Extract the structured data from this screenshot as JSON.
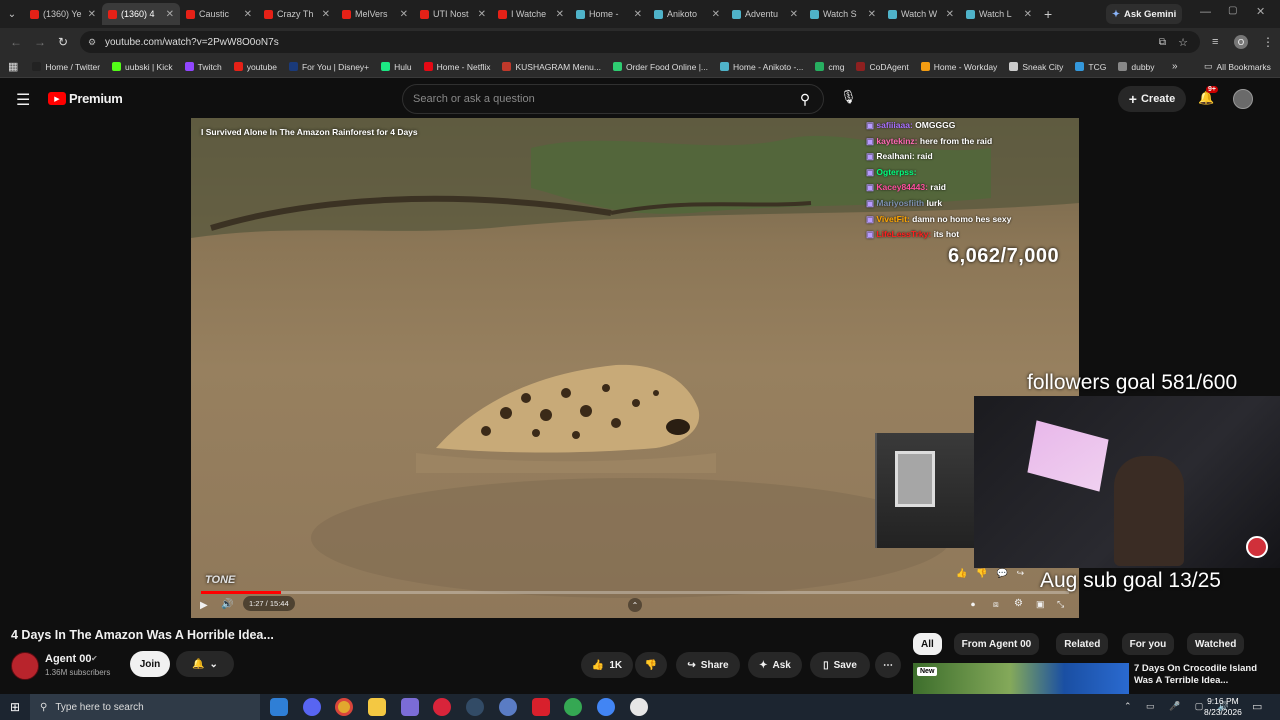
{
  "tabs": [
    {
      "title": "(1360) Ye",
      "color": "#e62117"
    },
    {
      "title": "(1360) 4",
      "color": "#e62117",
      "active": true
    },
    {
      "title": "Caustic",
      "color": "#e62117"
    },
    {
      "title": "Crazy Th",
      "color": "#e62117"
    },
    {
      "title": "MelVers",
      "color": "#e62117"
    },
    {
      "title": "UTI Nost",
      "color": "#e62117"
    },
    {
      "title": "I Watche",
      "color": "#e62117"
    },
    {
      "title": "Home -",
      "color": "#4fb3c9"
    },
    {
      "title": "Anikoto",
      "color": "#4fb3c9"
    },
    {
      "title": "Adventu",
      "color": "#4fb3c9"
    },
    {
      "title": "Watch S",
      "color": "#4fb3c9"
    },
    {
      "title": "Watch W",
      "color": "#4fb3c9"
    },
    {
      "title": "Watch L",
      "color": "#4fb3c9"
    }
  ],
  "ask_gemini": "Ask Gemini",
  "url": "youtube.com/watch?v=2PwW8O0oN7s",
  "bookmarks": [
    {
      "label": "Home / Twitter",
      "color": "#222"
    },
    {
      "label": "uubski | Kick",
      "color": "#53fc18"
    },
    {
      "label": "Twitch",
      "color": "#9146ff"
    },
    {
      "label": "youtube",
      "color": "#e62117"
    },
    {
      "label": "For You | Disney+",
      "color": "#1a3a7a"
    },
    {
      "label": "Hulu",
      "color": "#1ce783"
    },
    {
      "label": "Home - Netflix",
      "color": "#e50914"
    },
    {
      "label": "KUSHAGRAM Menu...",
      "color": "#c0392b"
    },
    {
      "label": "Order Food Online |...",
      "color": "#2ecc71"
    },
    {
      "label": "Home - Anikoto -...",
      "color": "#4fb3c9"
    },
    {
      "label": "cmg",
      "color": "#27ae60"
    },
    {
      "label": "CoDAgent",
      "color": "#8e2020"
    },
    {
      "label": "Home - Workday",
      "color": "#f39c12"
    },
    {
      "label": "Sneak City",
      "color": "#ccc"
    },
    {
      "label": "TCG",
      "color": "#3498db"
    },
    {
      "label": "dubby",
      "color": "#888"
    }
  ],
  "all_bookmarks": "All Bookmarks",
  "logo_text": "Premium",
  "search_placeholder": "Search or ask a question",
  "create_label": "Create",
  "notif_badge": "9+",
  "video": {
    "title_overlay": "I Survived Alone In The Amazon Rainforest for 4 Days",
    "time": "1:27 / 15:44",
    "progress": 0.092,
    "brand": "TONE",
    "goal_count": "6,062/7,000",
    "followers_goal": "followers goal 581/600",
    "sub_goal": "Aug sub goal 13/25"
  },
  "chat": [
    {
      "user": "safiiiaaa:",
      "msg": "OMGGGG",
      "color": "#a970ff"
    },
    {
      "user": "kaytekinz:",
      "msg": "here from the raid",
      "color": "#ff69b4"
    },
    {
      "user": "Realhani:",
      "msg": "raid",
      "color": "#ffffff"
    },
    {
      "user": "Ogterpss:",
      "msg": "",
      "color": "#00ff7f"
    },
    {
      "user": "Kacey84443:",
      "msg": "raid",
      "color": "#ff4fa0"
    },
    {
      "user": "Mariyosfiith",
      "msg": "lurk",
      "color": "#7d8fb0"
    },
    {
      "user": "VivetFit:",
      "msg": "damn no homo hes sexy",
      "color": "#ffa500"
    },
    {
      "user": "LifeLessTrky:",
      "msg": "its hot",
      "color": "#ff2020"
    }
  ],
  "meta": {
    "title": "4 Days In The Amazon Was A Horrible Idea...",
    "channel": "Agent 00",
    "subs": "1.36M subscribers",
    "join": "Join",
    "likes": "1K",
    "share": "Share",
    "ask": "Ask",
    "save": "Save"
  },
  "chips": [
    "All",
    "From Agent 00",
    "Related",
    "For you",
    "Watched"
  ],
  "rec": {
    "badge": "New",
    "title": "7 Days On Crocodile Island Was A Terrible Idea..."
  },
  "taskbar": {
    "search": "Type here to search",
    "time": "9:16 PM",
    "date": "8/23/2026"
  }
}
